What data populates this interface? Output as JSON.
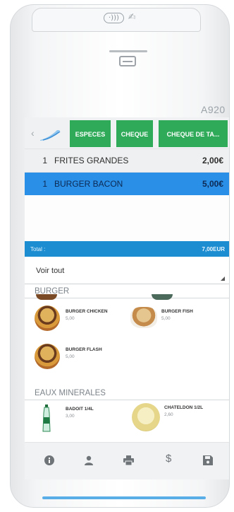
{
  "device": {
    "model": "A920",
    "nfc_symbol": "·)))",
    "signature_symbol": "✍"
  },
  "payment_bar": {
    "back_symbol": "‹",
    "buttons": [
      "ESPECES",
      "CHEQUE",
      "CHEQUE DE TA..."
    ]
  },
  "order": {
    "lines": [
      {
        "qty": "1",
        "name": "FRITES GRANDES",
        "price": "2,00€",
        "selected": false
      },
      {
        "qty": "1",
        "name": "BURGER BACON",
        "price": "5,00€",
        "selected": true
      }
    ],
    "total_label": "Total :",
    "total_value": "7,00EUR"
  },
  "filter": {
    "value": "Voir tout"
  },
  "categories": [
    {
      "title": "BURGER",
      "products": [
        {
          "name": "BURGER CHICKEN",
          "price": "5,00",
          "image": "burger-photo"
        },
        {
          "name": "BURGER FISH",
          "price": "5,00",
          "image": "fish-burger-photo"
        },
        {
          "name": "BURGER FLASH",
          "price": "5,00",
          "image": "burger-photo"
        }
      ]
    },
    {
      "title": "EAUX MINERALES",
      "products": [
        {
          "name": "BADOIT 1/4L",
          "price": "3,00",
          "image": "water-bottle-photo"
        },
        {
          "name": "CHATELDON 1/2L",
          "price": "2,60",
          "image": "chateldon-label-photo"
        }
      ]
    }
  ],
  "toolbar": {
    "icons": [
      "info-icon",
      "user-icon",
      "printer-icon",
      "dollar-icon",
      "save-icon"
    ],
    "dollar_symbol": "$"
  },
  "colors": {
    "pay_button": "#2eaa58",
    "selected_line": "#2a8fe6",
    "total_bar": "#1b8dd0"
  }
}
